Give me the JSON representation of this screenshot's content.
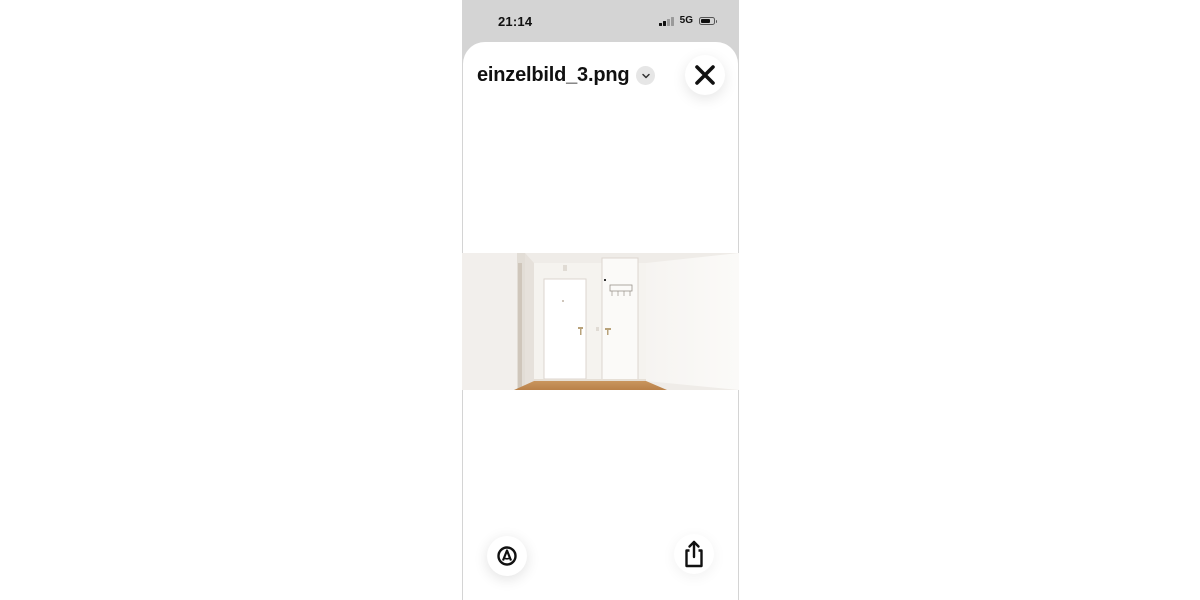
{
  "status_bar": {
    "time": "21:14",
    "network": "5G",
    "signal_bars_active": 2,
    "signal_bars_total": 4,
    "battery_level": 0.75
  },
  "viewer": {
    "file_name": "einzelbild_3.png",
    "icons": {
      "dropdown": "chevron-down-icon",
      "close": "close-icon",
      "markup": "markup-icon",
      "share": "share-icon"
    }
  },
  "colors": {
    "status_background": "#d4d4d4",
    "sheet_background": "#ffffff",
    "text": "#111111"
  },
  "photo": {
    "subject": "apartment-hallway",
    "wall_color": "#f4f1ec",
    "floor_color": "#c6925c"
  }
}
